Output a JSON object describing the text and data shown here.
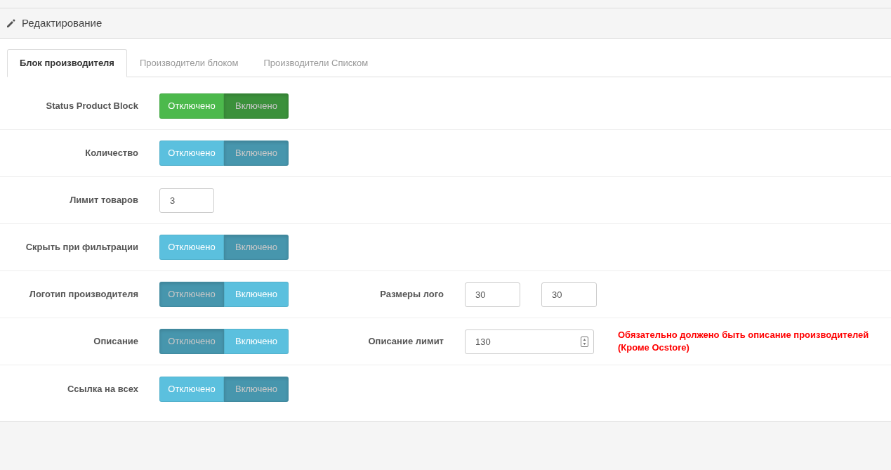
{
  "panel": {
    "title": "Редактирование"
  },
  "tabs": [
    {
      "label": "Блок производителя",
      "selected": true
    },
    {
      "label": "Производители блоком",
      "selected": false
    },
    {
      "label": "Производители Списком",
      "selected": false
    }
  ],
  "rows": [
    {
      "label": "Status Product Block",
      "kind": "toggle",
      "color": "#4cb94c",
      "options": [
        {
          "label": "Отключено",
          "selected": false
        },
        {
          "label": "Включено",
          "selected": true
        }
      ]
    },
    {
      "label": "Количество",
      "kind": "toggle",
      "color": "#5bc0de",
      "options": [
        {
          "label": "Отключено",
          "selected": false
        },
        {
          "label": "Включено",
          "selected": true
        }
      ]
    },
    {
      "label": "Лимит товаров",
      "kind": "input",
      "value": "3"
    },
    {
      "label": "Скрыть при фильтрации",
      "kind": "toggle",
      "color": "#5bc0de",
      "options": [
        {
          "label": "Отключено",
          "selected": false
        },
        {
          "label": "Включено",
          "selected": true
        }
      ]
    },
    {
      "label": "Логотип производителя",
      "kind": "toggle",
      "color": "#5bc0de",
      "options": [
        {
          "label": "Отключено",
          "selected": true
        },
        {
          "label": "Включено",
          "selected": false
        }
      ],
      "extra": {
        "label": "Размеры лого",
        "kind": "pair",
        "values": [
          "30",
          "30"
        ]
      }
    },
    {
      "label": "Описание",
      "kind": "toggle",
      "color": "#5bc0de",
      "options": [
        {
          "label": "Отключено",
          "selected": true
        },
        {
          "label": "Включено",
          "selected": false
        }
      ],
      "extra": {
        "label": "Описание лимит",
        "kind": "number",
        "value": "130",
        "note": "Обязательно должено быть описание производителей (Кроме Ocstore)"
      }
    },
    {
      "label": "Ссылка на всех",
      "kind": "toggle",
      "color": "#5bc0de",
      "options": [
        {
          "label": "Отключено",
          "selected": false
        },
        {
          "label": "Включено",
          "selected": true
        }
      ]
    }
  ]
}
